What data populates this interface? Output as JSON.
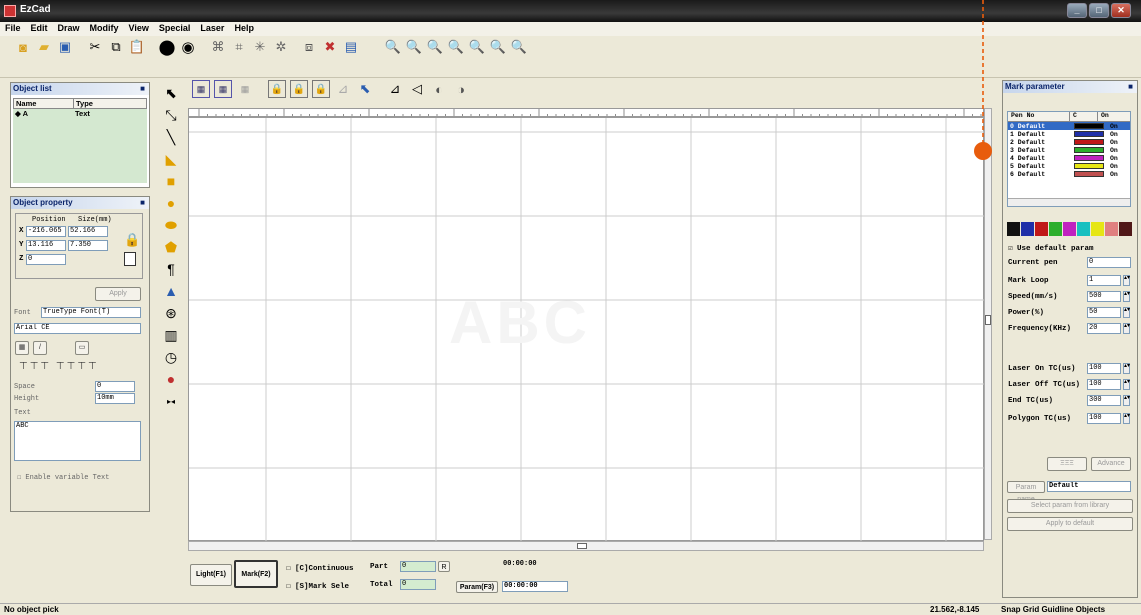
{
  "window": {
    "title": "EzCad"
  },
  "menu": [
    "File",
    "Edit",
    "Draw",
    "Modify",
    "View",
    "Special",
    "Laser",
    "Help"
  ],
  "object_list": {
    "title": "Object list",
    "columns": [
      "Name",
      "Type"
    ],
    "rows": [
      {
        "name": "A",
        "type": "Text"
      }
    ]
  },
  "object_property": {
    "title": "Object property",
    "headers": [
      "Position",
      "Size(mm)"
    ],
    "x": {
      "pos": "-216.065",
      "size": "52.166"
    },
    "y": {
      "pos": "13.116",
      "size": "7.350"
    },
    "z": {
      "pos": "0"
    },
    "apply_label": "Apply",
    "font_label": "Font",
    "font_type": "TrueType Font(T)",
    "font_name": "Arial CE",
    "space_label": "Space",
    "space_value": "0",
    "height_label": "Height",
    "height_value": "10mm",
    "text_label": "Text",
    "text_value": "ABC",
    "variable_text_label": "Enable variable Text"
  },
  "mark_parameter": {
    "title": "Mark parameter",
    "columns": [
      "Pen No",
      "C",
      "On"
    ],
    "pens": [
      {
        "no": "0 Default",
        "color": "#000000",
        "on": "On"
      },
      {
        "no": "1 Default",
        "color": "#1f2fa8",
        "on": "On"
      },
      {
        "no": "2 Default",
        "color": "#c01818",
        "on": "On"
      },
      {
        "no": "3 Default",
        "color": "#2cae2c",
        "on": "On"
      },
      {
        "no": "4 Default",
        "color": "#c022c0",
        "on": "On"
      },
      {
        "no": "5 Default",
        "color": "#e6e615",
        "on": "On"
      },
      {
        "no": "6 Default",
        "color": "#c05050",
        "on": "On"
      }
    ],
    "palette": [
      "#111111",
      "#1f2fa8",
      "#c01818",
      "#2cae2c",
      "#c022c0",
      "#18c0c0",
      "#e6e615",
      "#e08080",
      "#501818"
    ],
    "use_default_label": "Use default param",
    "current_pen_label": "Current pen",
    "current_pen": "0",
    "fields": [
      {
        "label": "Mark Loop",
        "value": "1"
      },
      {
        "label": "Speed(mm/s)",
        "value": "500"
      },
      {
        "label": "Power(%)",
        "value": "50"
      },
      {
        "label": "Frequency(KHz)",
        "value": "20"
      },
      {
        "label": "Laser On TC(us)",
        "value": "100"
      },
      {
        "label": "Laser Off TC(us)",
        "value": "100"
      },
      {
        "label": "End TC(us)",
        "value": "300"
      },
      {
        "label": "Polygon TC(us)",
        "value": "100"
      }
    ],
    "advance_label": "Advance",
    "param_name_label": "Param name",
    "param_name_value": "Default",
    "select_library_label": "Select param from library",
    "apply_default_label": "Apply to default"
  },
  "bottom": {
    "light_label": "Light(F1)",
    "mark_label": "Mark(F2)",
    "continuous_label": "[C]Continuous",
    "part_label": "Part",
    "part_value": "0",
    "mark_sele_label": "[S]Mark Sele",
    "total_label": "Total",
    "total_value": "0",
    "param_label": "Param(F3)",
    "time1": "00:00:00",
    "time2": "00:00:00"
  },
  "status": {
    "left": "No object pick",
    "coords": "21.562,-8.145",
    "snap": "Snap Grid Guidline Objects"
  },
  "canvas_text": "ABC",
  "colors": {
    "accent": "#e85c0c",
    "dashed_line": "#e85c0c"
  }
}
